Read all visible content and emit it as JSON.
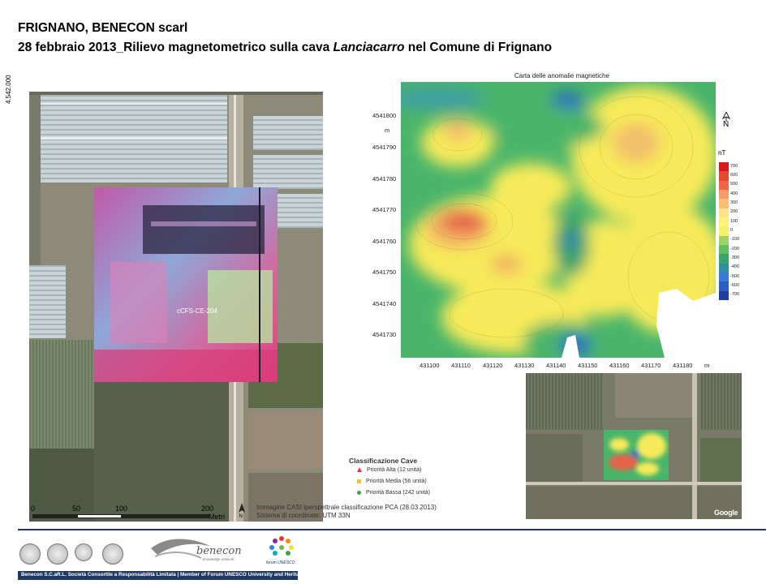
{
  "title": {
    "line1": "FRIGNANO, BENECON scarl",
    "line2_prefix": "28 febbraio 2013_Rilievo magnetometrico sulla cava ",
    "line2_site": "Lanciacarro",
    "line2_suffix": " nel Comune di Frignano"
  },
  "aerial": {
    "northing_label": "4.542.000",
    "overlay_label": "cCFS-CE-204",
    "scale": {
      "ticks": [
        "0",
        "50",
        "100",
        "200"
      ],
      "unit": "Metri"
    },
    "legend": {
      "title": "Classificazione Cave",
      "items": [
        {
          "label": "Priorità Alta (12 unità)",
          "color": "#e53935"
        },
        {
          "label": "Priorità Media (56 unità)",
          "color": "#f0c040"
        },
        {
          "label": "Priorità Bassa (242 unità)",
          "color": "#43a047"
        }
      ]
    },
    "caption_line1": "Immagine CASI iperspettrale classificazione PCA (28.03.2013)",
    "caption_line2": "Sistema di coordinate: UTM 33N"
  },
  "magnetic_map": {
    "title": "Carta delle anomalie magnetiche",
    "y_ticks": [
      "4541800",
      "4541790",
      "4541780",
      "4541770",
      "4541760",
      "4541750",
      "4541740",
      "4541730"
    ],
    "y_unit": "m",
    "x_ticks": [
      "431100",
      "431110",
      "431120",
      "431130",
      "431140",
      "431150",
      "431160",
      "431170",
      "431180"
    ],
    "x_unit": "m",
    "north": "N",
    "colorbar": {
      "unit": "nT",
      "labels": [
        "700",
        "600",
        "500",
        "400",
        "300",
        "200",
        "100",
        "0",
        "-100",
        "-200",
        "-300",
        "-400",
        "-500",
        "-600",
        "-700"
      ],
      "colors": [
        "#d7191c",
        "#e34a33",
        "#ef6548",
        "#f79b6b",
        "#fdbf6f",
        "#fde38a",
        "#fff27a",
        "#f7f06a",
        "#9fd36a",
        "#5fbf5f",
        "#3aa46e",
        "#2e8fa0",
        "#3a7bd5",
        "#2b5fbf",
        "#1f3d9e"
      ]
    }
  },
  "satellite": {
    "watermark": "Google"
  },
  "footer": {
    "text": "Benecon S.C.aR.L. Società Consortile a Responsabilità Limitata | Member of Forum UNESCO University and Heritage",
    "logo_benecon": "benecon",
    "logo_benecon_sub": "knowledge network",
    "logo_forum": "forum UNESCO"
  }
}
